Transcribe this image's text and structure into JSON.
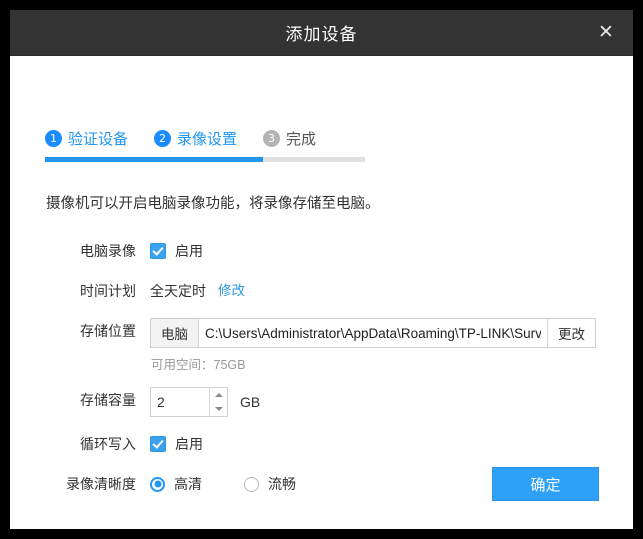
{
  "window": {
    "title": "添加设备",
    "close_icon": "close-icon"
  },
  "steps": {
    "items": [
      {
        "number": "1",
        "label": "验证设备",
        "state": "active"
      },
      {
        "number": "2",
        "label": "录像设置",
        "state": "active"
      },
      {
        "number": "3",
        "label": "完成",
        "state": "inactive"
      }
    ],
    "progress_percent": 68
  },
  "description": "摄像机可以开启电脑录像功能，将录像存储至电脑。",
  "form": {
    "pc_record": {
      "label": "电脑录像",
      "checkbox_label": "启用",
      "checked": true
    },
    "schedule": {
      "label": "时间计划",
      "value": "全天定时",
      "link": "修改"
    },
    "storage_location": {
      "label": "存储位置",
      "prefix_button": "电脑",
      "path": "C:\\Users\\Administrator\\AppData\\Roaming\\TP-LINK\\Surv",
      "change_button": "更改",
      "hint": "可用空间：75GB"
    },
    "storage_capacity": {
      "label": "存储容量",
      "value": "2",
      "unit": "GB",
      "increment_icon": "chevron-up-icon",
      "decrement_icon": "chevron-down-icon"
    },
    "cyclic_write": {
      "label": "循环写入",
      "checkbox_label": "启用",
      "checked": true
    },
    "quality": {
      "label": "录像清晰度",
      "options": [
        {
          "label": "高清",
          "selected": true
        },
        {
          "label": "流畅",
          "selected": false
        }
      ]
    }
  },
  "footer": {
    "confirm_label": "确定"
  },
  "colors": {
    "accent": "#2196f3",
    "button": "#2fa0f7",
    "titlebar": "#333333",
    "link": "#2f9ae0"
  }
}
